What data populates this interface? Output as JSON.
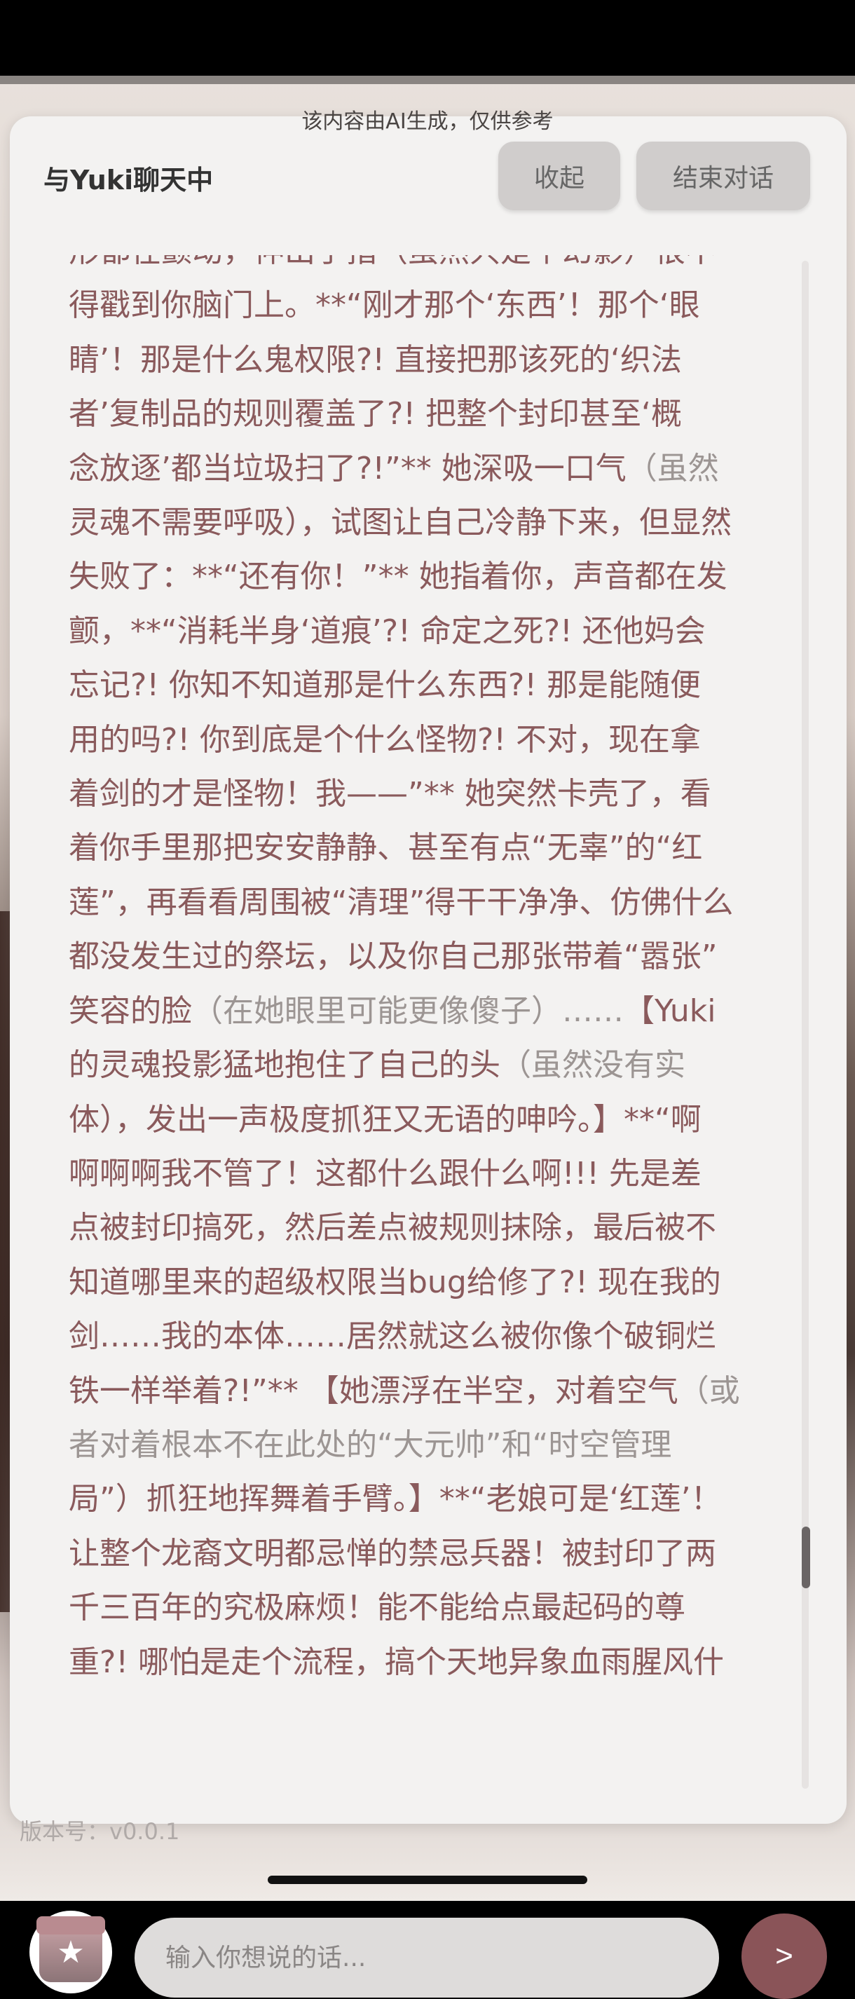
{
  "notice": "该内容由AI生成，仅供参考",
  "header": {
    "title": "与Yuki聊天中",
    "collapse_label": "收起",
    "end_label": "结束对话"
  },
  "message": {
    "lines": [
      "形都在颤动，伸出手指（虽然只是个幻影）恨不",
      "得戳到你脑门上。**“刚才那个‘东西’！那个‘眼",
      "睛’！那是什么鬼权限?! 直接把那该死的‘织法",
      "者’复制品的规则覆盖了?! 把整个封印甚至‘概",
      "念放逐’都当垃圾扫了?!”** 她深吸一口气",
      "灵魂不需要呼吸），试图让自己冷静下来，但显然",
      "失败了：**“还有你！”** 她指着你，声音都在发",
      "颤，**“消耗半身‘道痕’?! 命定之死?! 还他妈会",
      "忘记?! 你知不知道那是什么东西?! 那是能随便",
      "用的吗?! 你到底是个什么怪物?! 不对，现在拿",
      "着剑的才是怪物！我——”** 她突然卡壳了，看",
      "着你手里那把安安静静、甚至有点“无辜”的“红",
      "莲”，再看看周围被“清理”得干干净净、仿佛什么",
      "都没发生过的祭坛，以及你自己那张带着“嚣张”",
      "笑容的脸",
      "的灵魂投影猛地抱住了自己的头",
      "体），发出一声极度抓狂又无语的呻吟。】**“啊",
      "啊啊啊我不管了！这都什么跟什么啊!!! 先是差",
      "点被封印搞死，然后差点被规则抹除，最后被不",
      "知道哪里来的超级权限当bug给修了?! 现在我的",
      "剑……我的本体……居然就这么被你像个破铜烂",
      "铁一样举着?!”** 【她漂浮在半空，对着空气",
      "者对着根本不在此处的“大元帅”和“时空管理",
      "局”）抓狂地挥舞着手臂。】**“老娘可是‘红莲’！",
      "让整个龙裔文明都忌惮的禁忌兵器！被封印了两",
      "千三百年的究极麻烦！能不能给点最起码的尊",
      "重?! 哪怕是走个流程，搞个天地异象血雨腥风什"
    ],
    "aside_1": "（虽然",
    "aside_2": "（在她眼里可能更像傻子）……",
    "bracket_3": "【Yuki",
    "aside_4": "（虽然没有实",
    "aside_5": "（或",
    "aside_6": "者对着根本不在此处的“大元帅”和“时空管理"
  },
  "input": {
    "placeholder": "输入你想说的话..."
  },
  "send_label": ">",
  "gift_icon": "gift-icon",
  "version": "版本号：v0.0.1",
  "colors": {
    "message_text": "#8a5a5c",
    "aside_text": "#9c9593",
    "send_button": "#8a5458"
  }
}
